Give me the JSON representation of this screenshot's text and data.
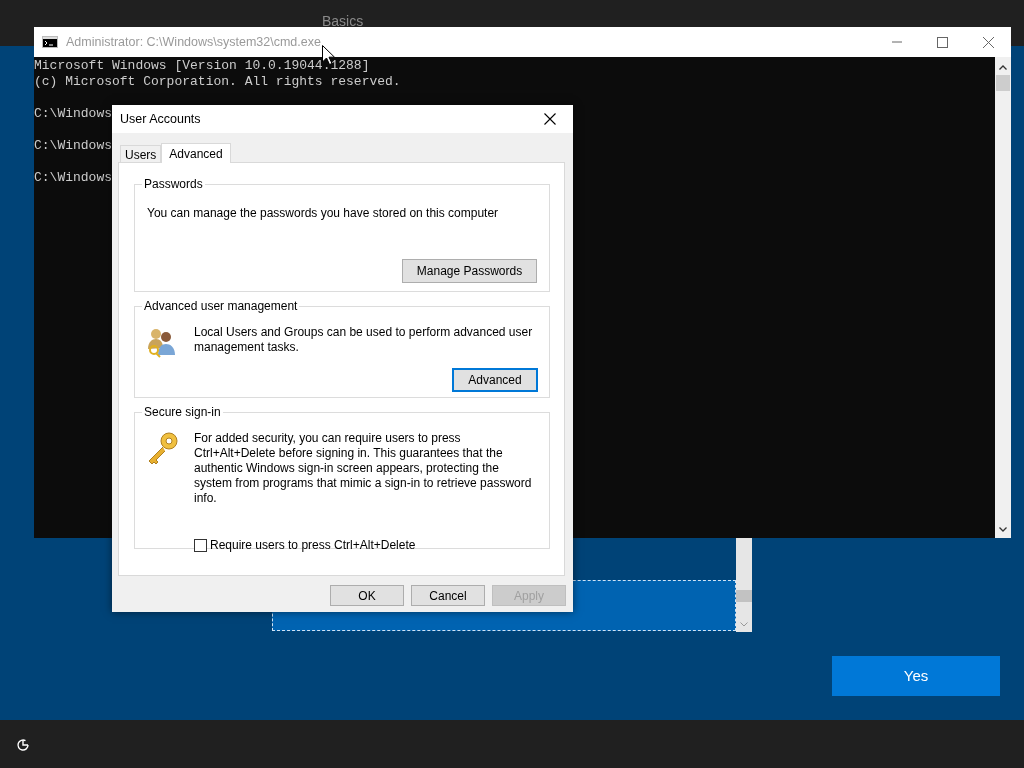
{
  "header": {
    "title": "Basics"
  },
  "console_window": {
    "title": "Administrator: C:\\Windows\\system32\\cmd.exe",
    "blocks": [
      [
        "Microsoft Windows [Version 10.0.19044.1288]",
        "(c) Microsoft Corporation. All rights reserved."
      ],
      [
        "C:\\Windows"
      ],
      [
        "C:\\Windows"
      ],
      [
        "C:\\Windows"
      ]
    ]
  },
  "dialog": {
    "title": "User Accounts",
    "tabs": [
      {
        "label": "Users",
        "selected": false
      },
      {
        "label": "Advanced",
        "selected": true
      }
    ],
    "groups": [
      {
        "kind": "passwords",
        "title": "Passwords",
        "text": "You can manage the passwords you have stored on this computer",
        "button": {
          "label": "Manage Passwords",
          "focused": false
        }
      },
      {
        "kind": "management",
        "title": "Advanced user management",
        "text": "Local Users and Groups can be used to perform advanced user management tasks.",
        "button": {
          "label": "Advanced",
          "focused": true
        }
      },
      {
        "kind": "sign-in",
        "title": "Secure sign-in",
        "text": "For added security, you can require users to press Ctrl+Alt+Delete before signing in. This guarantees that the authentic Windows sign-in screen appears, protecting the system from programs that mimic a sign-in to retrieve password info.",
        "checkbox": {
          "label": "Require users to press Ctrl+Alt+Delete",
          "checked": false
        }
      }
    ],
    "buttons": [
      {
        "label": "OK",
        "disabled": false
      },
      {
        "label": "Cancel",
        "disabled": false
      },
      {
        "label": "Apply",
        "disabled": true
      }
    ]
  },
  "yes_button": {
    "label": "Yes"
  }
}
